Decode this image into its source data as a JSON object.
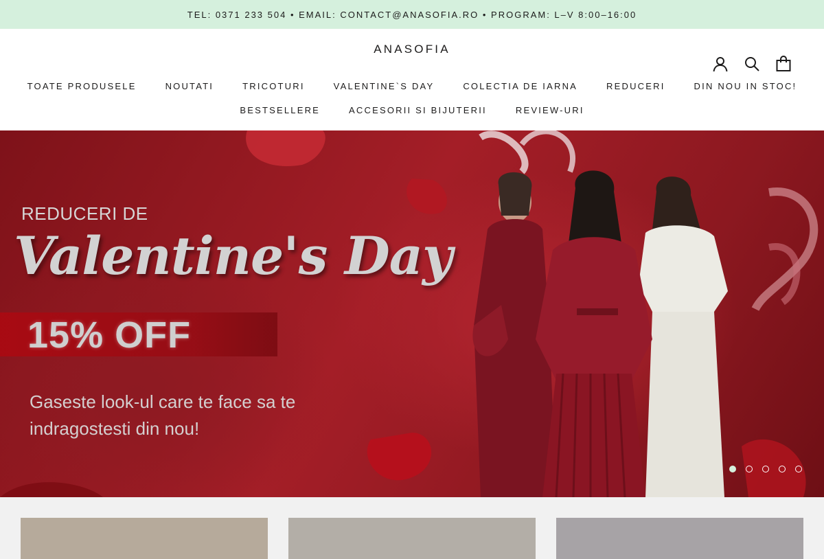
{
  "announcement": "TEL: 0371 233 504 • EMAIL: CONTACT@ANASOFIA.RO • PROGRAM: L–V 8:00–16:00",
  "header": {
    "logo": "ANASOFIA",
    "nav_row1": [
      "TOATE PRODUSELE",
      "NOUTATI",
      "TRICOTURI",
      "VALENTINE`S DAY",
      "COLECTIA DE IARNA",
      "REDUCERI",
      "DIN NOU IN STOC!"
    ],
    "nav_row2": [
      "BESTSELLERE",
      "ACCESORII SI BIJUTERII",
      "REVIEW-URI"
    ],
    "icons": [
      "account-icon",
      "search-icon",
      "cart-icon"
    ]
  },
  "hero": {
    "subtitle": "REDUCERI DE",
    "title": "Valentine's Day",
    "badge": "15% OFF",
    "description": "Gaseste look-ul care te face sa te indragostesti din nou!",
    "slide_count": 5,
    "active_slide": 1
  },
  "colors": {
    "announcement_bg": "#d5f0dd",
    "hero_red": "#a41e27",
    "text": "#1c1b1b"
  }
}
